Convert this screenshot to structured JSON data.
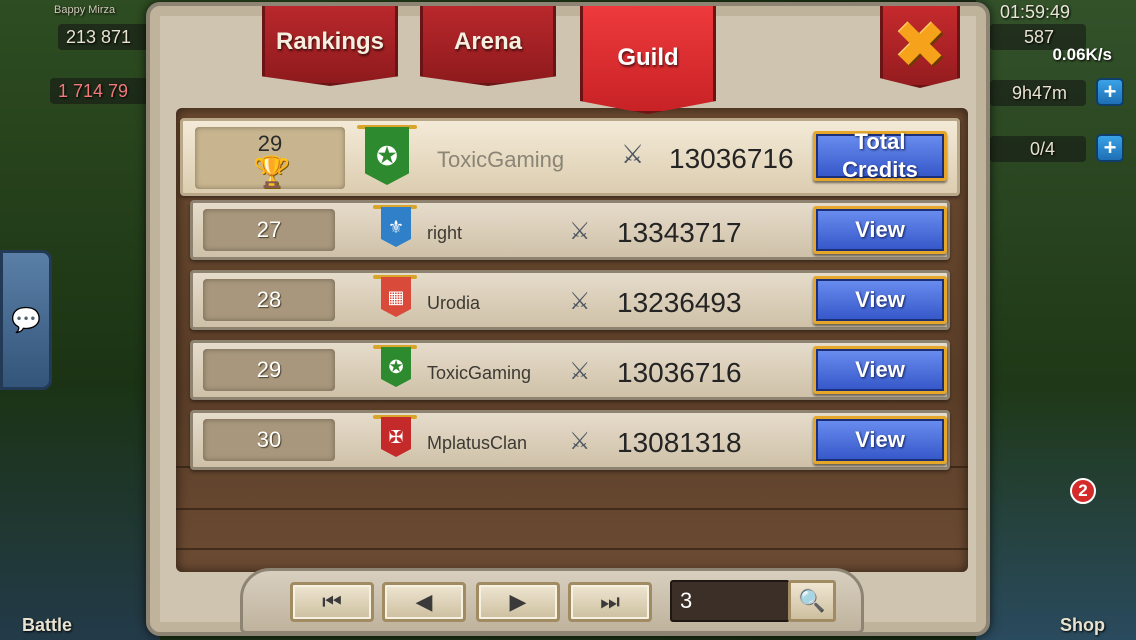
{
  "hud": {
    "player_name": "Bappy Mirza",
    "gold": "213 871",
    "might": "1 714 79",
    "clock": "01:59:49",
    "gems": "587",
    "timer": "9h47m",
    "energy": "0/4",
    "rate": "0.06K/s",
    "notification_count": "2",
    "bottom_left_label": "Battle",
    "bottom_right_label": "Shop"
  },
  "tabs": [
    {
      "label": "Rankings",
      "active": false
    },
    {
      "label": "Arena",
      "active": false
    },
    {
      "label": "Guild",
      "active": true
    }
  ],
  "my_guild": {
    "rank": "29",
    "name": "ToxicGaming",
    "score": "13036716",
    "button": "Total Credits",
    "banner_color": "#2e8a2e"
  },
  "rows": [
    {
      "rank": "27",
      "name": "right",
      "score": "13343717",
      "button": "View",
      "banner_color": "#2f7fc9",
      "banner_icon": "⚜"
    },
    {
      "rank": "28",
      "name": "Urodia",
      "score": "13236493",
      "button": "View",
      "banner_color": "#d94a3a",
      "banner_icon": "▦"
    },
    {
      "rank": "29",
      "name": "ToxicGaming",
      "score": "13036716",
      "button": "View",
      "banner_color": "#2e8a2e",
      "banner_icon": "✪"
    },
    {
      "rank": "30",
      "name": "MplatusClan",
      "score": "13081318",
      "button": "View",
      "banner_color": "#c42a2a",
      "banner_icon": "✠"
    }
  ],
  "pagination": {
    "first": "⏮",
    "prev": "◀",
    "next": "▶",
    "last": "⏭",
    "page_value": "3",
    "search_icon": "🔍"
  }
}
